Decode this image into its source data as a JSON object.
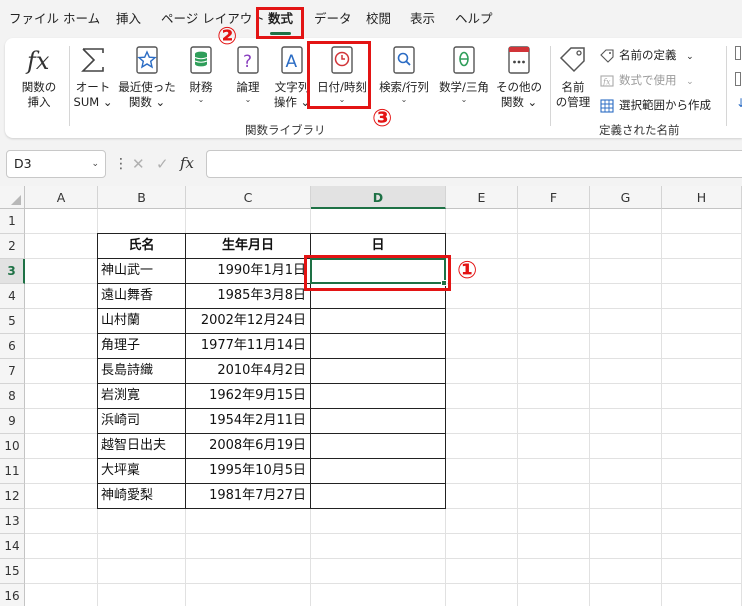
{
  "menu": {
    "tabs": [
      "ファイル",
      "ホーム",
      "挿入",
      "ページ レイアウト",
      "数式",
      "データ",
      "校閲",
      "表示",
      "ヘルプ"
    ],
    "active_tab": "数式"
  },
  "ribbon": {
    "insert_function": {
      "line1": "関数の",
      "line2": "挿入",
      "icon": "fx-icon"
    },
    "autosum": {
      "line1": "オート",
      "line2": "SUM ⌄",
      "icon": "sigma-icon"
    },
    "recently_used": {
      "line1": "最近使った",
      "line2": "関数 ⌄",
      "icon": "star-icon"
    },
    "financial": {
      "line1": "財務",
      "icon": "database-icon"
    },
    "logical": {
      "line1": "論理",
      "icon": "question-book-icon"
    },
    "text": {
      "line1": "文字列",
      "line2": "操作 ⌄",
      "icon": "text-a-icon"
    },
    "datetime": {
      "line1": "日付/時刻",
      "icon": "clock-book-icon"
    },
    "lookup": {
      "line1": "検索/行列",
      "icon": "search-book-icon"
    },
    "math": {
      "line1": "数学/三角",
      "icon": "theta-book-icon"
    },
    "more": {
      "line1": "その他の",
      "line2": "関数 ⌄",
      "icon": "more-book-icon"
    },
    "function_library_label": "関数ライブラリ",
    "name_manager": {
      "line1": "名前",
      "line2": "の管理",
      "icon": "tag-icon"
    },
    "define_name": "名前の定義",
    "use_in_formula": "数式で使用",
    "create_from_selection": "選択範囲から作成",
    "defined_names_label": "定義された名前"
  },
  "formula_bar": {
    "name_box": "D3",
    "formula": ""
  },
  "sheet": {
    "columns": [
      "A",
      "B",
      "C",
      "D",
      "E",
      "F",
      "G",
      "H"
    ],
    "rows": [
      "1",
      "2",
      "3",
      "4",
      "5",
      "6",
      "7",
      "8",
      "9",
      "10",
      "11",
      "12",
      "13",
      "14",
      "15",
      "16"
    ],
    "selected_cell": "D3",
    "headers": [
      "氏名",
      "生年月日",
      "日"
    ],
    "data": [
      {
        "name": "神山武一",
        "birth": "1990年1月1日",
        "day": ""
      },
      {
        "name": "遠山舞香",
        "birth": "1985年3月8日",
        "day": ""
      },
      {
        "name": "山村蘭",
        "birth": "2002年12月24日",
        "day": ""
      },
      {
        "name": "角理子",
        "birth": "1977年11月14日",
        "day": ""
      },
      {
        "name": "長島詩織",
        "birth": "2010年4月2日",
        "day": ""
      },
      {
        "name": "岩渕寛",
        "birth": "1962年9月15日",
        "day": ""
      },
      {
        "name": "浜崎司",
        "birth": "1954年2月11日",
        "day": ""
      },
      {
        "name": "越智日出夫",
        "birth": "2008年6月19日",
        "day": ""
      },
      {
        "name": "大坪稟",
        "birth": "1995年10月5日",
        "day": ""
      },
      {
        "name": "神崎愛梨",
        "birth": "1981年7月27日",
        "day": ""
      }
    ]
  },
  "annotations": {
    "marker1": "①",
    "marker2": "②",
    "marker3": "③",
    "color": "#e31414"
  },
  "colors": {
    "accent": "#1e7145",
    "annotation_red": "#e31414"
  }
}
